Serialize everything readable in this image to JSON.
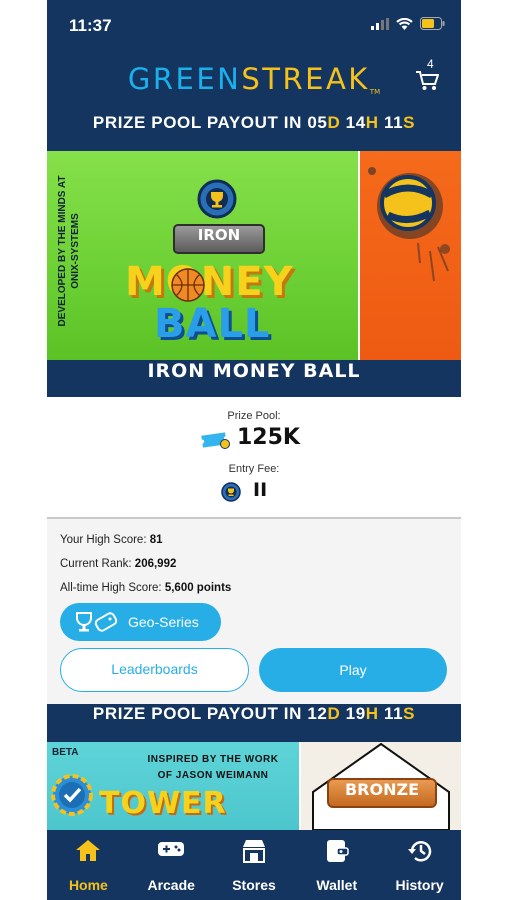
{
  "status_bar": {
    "time": "11:37"
  },
  "header": {
    "logo_part1": "GREEN",
    "logo_part2": "STREAK",
    "logo_tm": "TM",
    "cart_count": "4"
  },
  "payout_banner_1": {
    "prefix": "PRIZE POOL PAYOUT IN ",
    "days": "05",
    "d": "D",
    "hours": "14",
    "h": "H",
    "mins": "11",
    "s": "S"
  },
  "game_1": {
    "developer_line1": "DEVELOPED BY THE MINDS AT",
    "developer_line2": "ONIX-SYSTEMS",
    "tier_badge": "IRON",
    "logo_line1": "MONEY",
    "logo_line2": "BALL",
    "title": "IRON MONEY BALL",
    "prize_label": "Prize Pool:",
    "prize_value": "125K",
    "entry_label": "Entry Fee:",
    "entry_value": "II"
  },
  "stats": {
    "high_score_label": "Your High Score:",
    "high_score_value": "81",
    "rank_label": "Current Rank:",
    "rank_value": "206,992",
    "alltime_label": "All-time High Score:",
    "alltime_value": "5,600 points",
    "geo_series_label": "Geo-Series",
    "leaderboards_label": "Leaderboards",
    "play_label": "Play"
  },
  "payout_banner_2": {
    "prefix": "PRIZE POOL PAYOUT IN ",
    "days": "12",
    "d": "D",
    "hours": "19",
    "h": "H",
    "mins": "11",
    "s": "S"
  },
  "game_2": {
    "beta_label": "BETA",
    "inspired_line1": "INSPIRED BY THE WORK",
    "inspired_line2": "OF JASON WEIMANN",
    "logo_word": "TOWER",
    "tier_badge": "BRONZE"
  },
  "tabbar": {
    "items": [
      {
        "label": "Home",
        "icon": "home-icon",
        "active": true
      },
      {
        "label": "Arcade",
        "icon": "gamepad-icon",
        "active": false
      },
      {
        "label": "Stores",
        "icon": "store-icon",
        "active": false
      },
      {
        "label": "Wallet",
        "icon": "wallet-icon",
        "active": false
      },
      {
        "label": "History",
        "icon": "history-icon",
        "active": false
      }
    ]
  },
  "colors": {
    "navy": "#14355f",
    "accent_blue": "#28aee6",
    "gold": "#f5c21b"
  }
}
